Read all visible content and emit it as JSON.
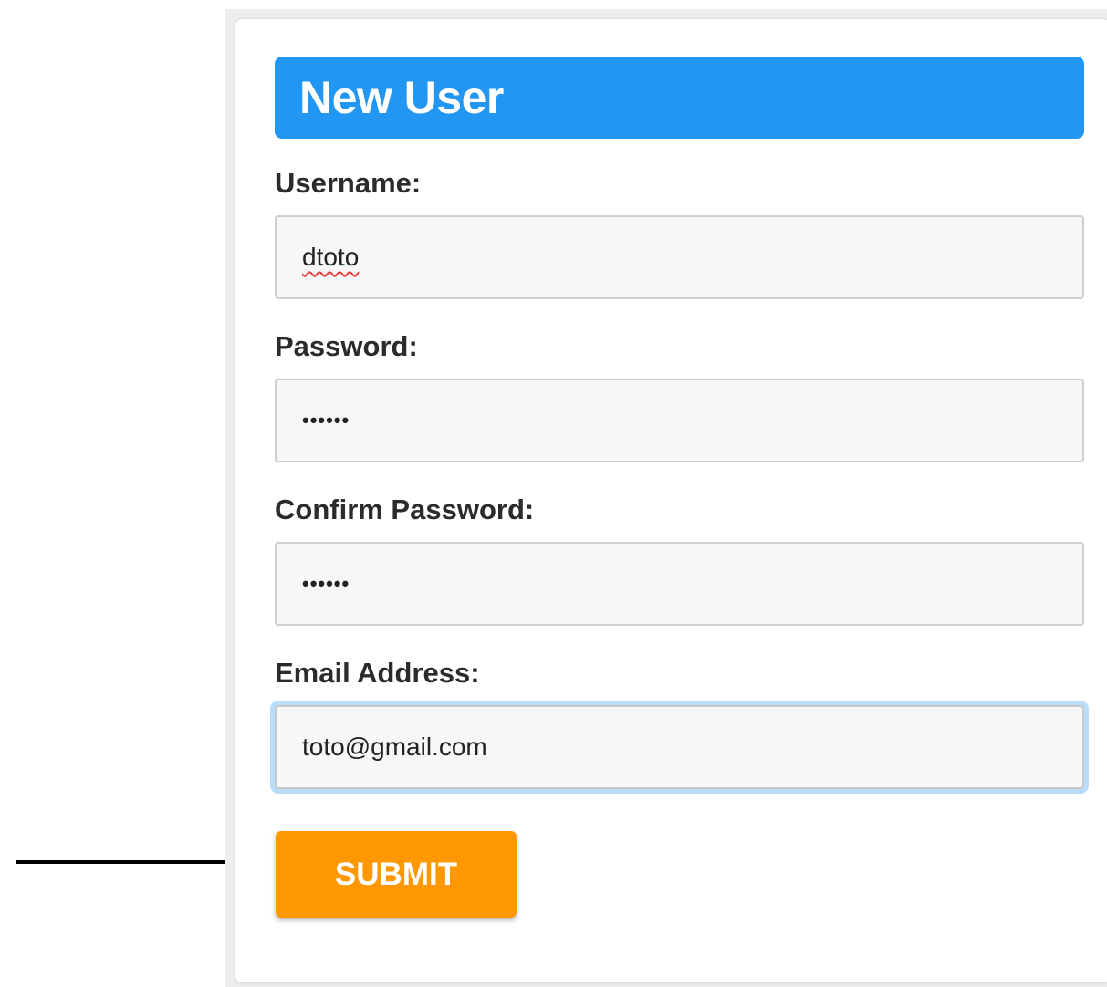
{
  "form": {
    "title": "New User",
    "fields": [
      {
        "label": "Username:",
        "value": "dtoto"
      },
      {
        "label": "Password:",
        "value": "••••••"
      },
      {
        "label": "Confirm Password:",
        "value": "••••••"
      },
      {
        "label": "Email Address:",
        "value": "toto@gmail.com"
      }
    ],
    "submit_label": "SUBMIT"
  },
  "colors": {
    "header": "#2196f3",
    "submit": "#ff9800",
    "focus_ring": "#b9dcfb",
    "spellcheck": "#e53935"
  },
  "icons": {
    "pointer": "arrow-right-icon"
  }
}
